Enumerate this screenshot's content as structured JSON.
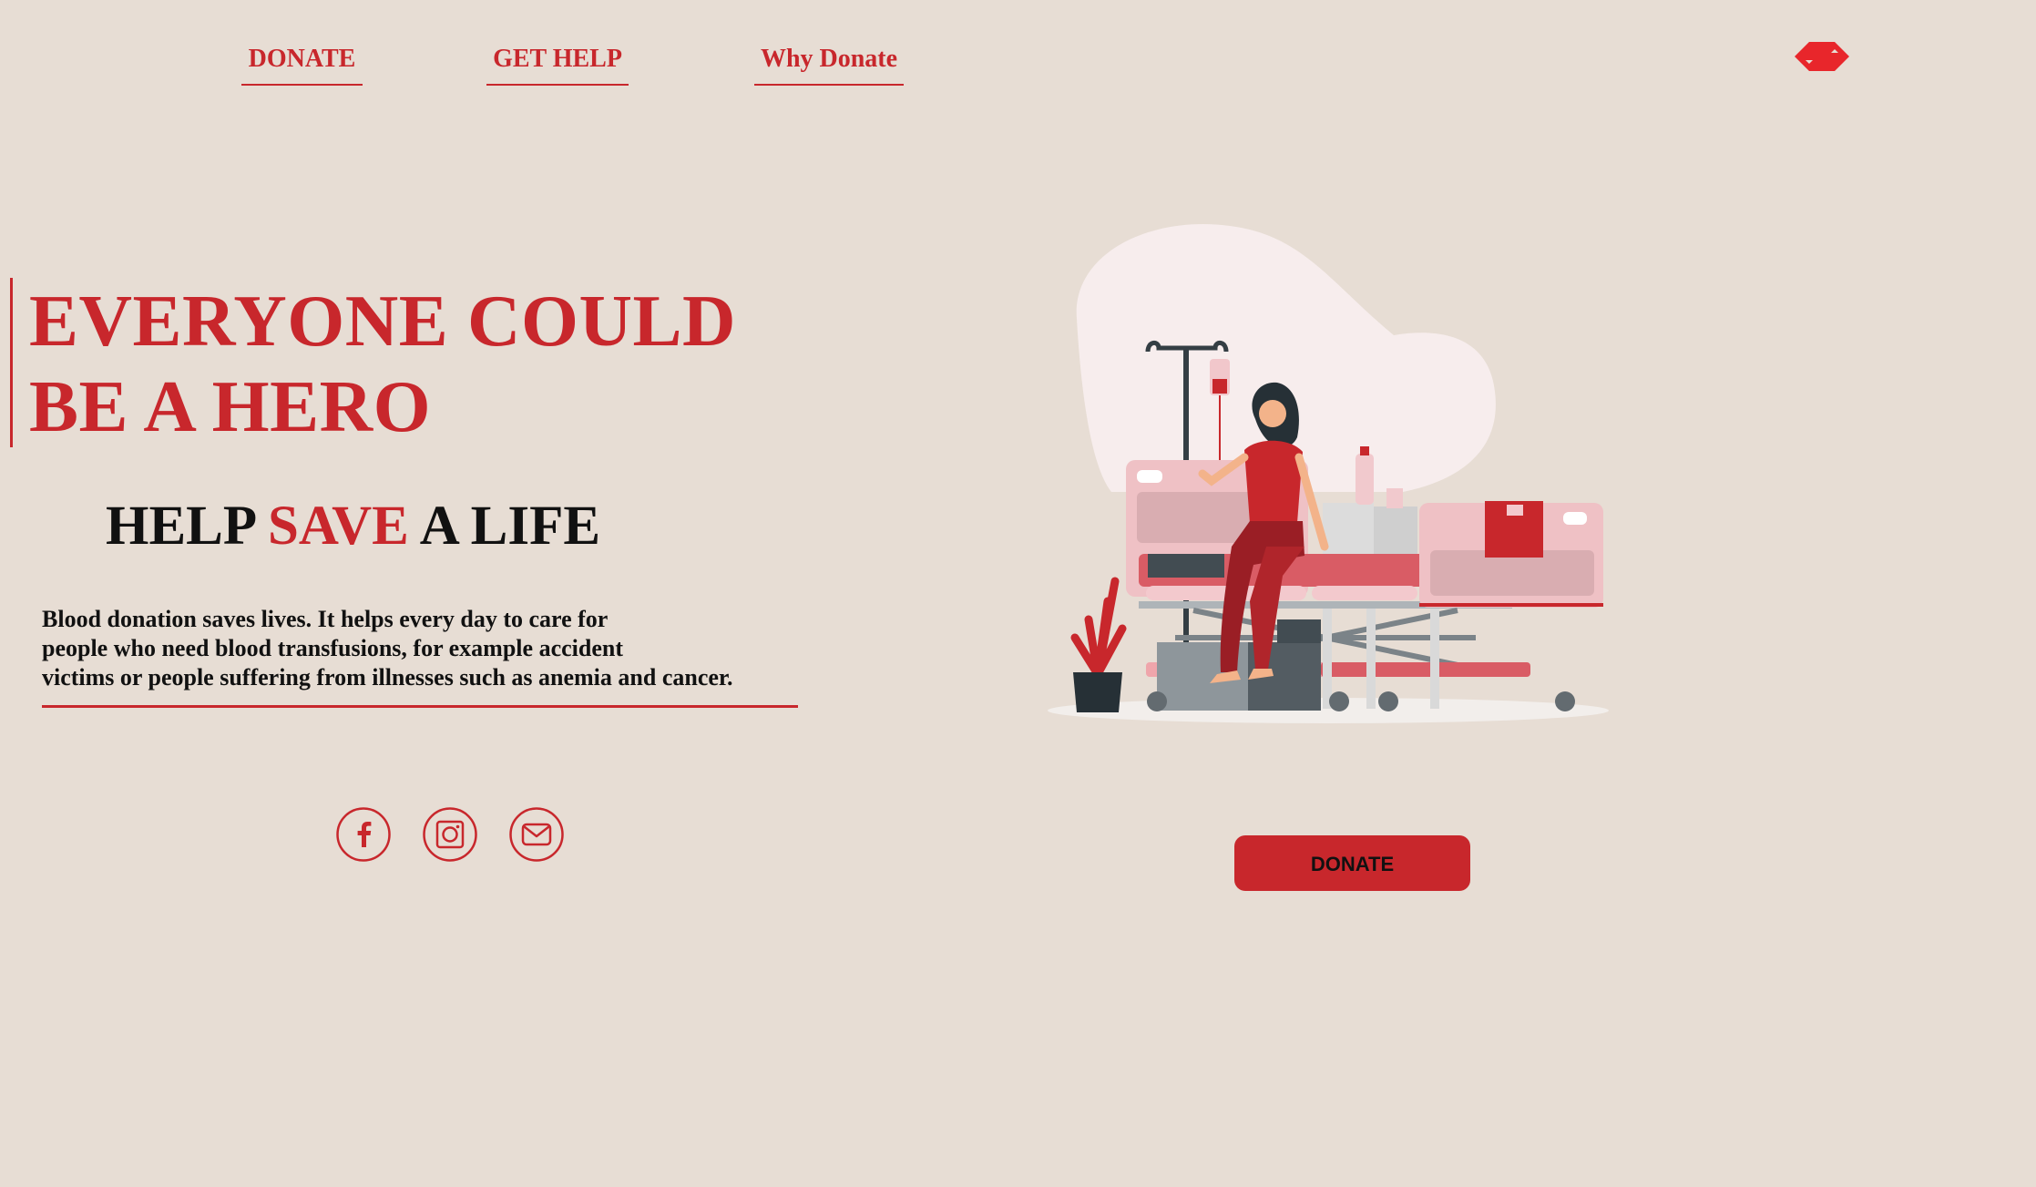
{
  "nav": {
    "items": [
      {
        "label": "DONATE"
      },
      {
        "label": "GET HELP"
      },
      {
        "label": "Why Donate"
      }
    ]
  },
  "logo": {
    "icon": "brand-logo-icon",
    "color": "#e8262b"
  },
  "hero": {
    "headline_line1": "EVERYONE COULD",
    "headline_line2": "BE A HERO",
    "subhead_before": "HELP ",
    "subhead_accent": "SAVE",
    "subhead_after": " A LIFE",
    "description_line1": "Blood donation saves lives. It helps every day to care for",
    "description_line2": "people who need blood transfusions, for example accident",
    "description_line3": "victims or people suffering from illnesses such as anemia and cancer."
  },
  "social": [
    {
      "icon": "facebook-icon"
    },
    {
      "icon": "instagram-icon"
    },
    {
      "icon": "mail-icon"
    }
  ],
  "cta": {
    "label": "DONATE"
  },
  "colors": {
    "accent": "#c8272c",
    "background": "#e7ddd4",
    "text": "#111111"
  }
}
